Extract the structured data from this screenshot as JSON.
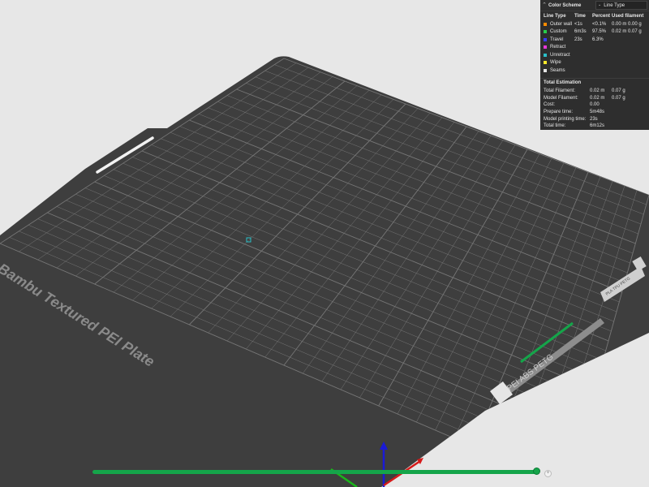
{
  "plate": {
    "label": "Bambu Textured PEI Plate",
    "sticker_main": "PEI ABS PETG",
    "sticker_side": "PLA TPU PETG"
  },
  "panel": {
    "color_scheme_label": "Color Scheme",
    "color_scheme_value": "Line Type",
    "columns": [
      "Line Type",
      "Time",
      "Percent",
      "Used filament"
    ],
    "rows": [
      {
        "label": "Outer wall",
        "color": "#ff8c00",
        "time": "<1s",
        "percent": "<0.1%",
        "used": "0.00 m  0.00 g"
      },
      {
        "label": "Custom",
        "color": "#28cc4a",
        "time": "6m3s",
        "percent": "97.5%",
        "used": "0.02 m  0.07 g"
      },
      {
        "label": "Travel",
        "color": "#3a3dff",
        "time": "23s",
        "percent": "6.3%",
        "used": ""
      },
      {
        "label": "Retract",
        "color": "#e838d9",
        "time": "",
        "percent": "",
        "used": ""
      },
      {
        "label": "Unretract",
        "color": "#2ac0c8",
        "time": "",
        "percent": "",
        "used": ""
      },
      {
        "label": "Wipe",
        "color": "#ffe82a",
        "time": "",
        "percent": "",
        "used": ""
      },
      {
        "label": "Seams",
        "color": "#e6e6e6",
        "time": "",
        "percent": "",
        "used": ""
      }
    ],
    "total_estimation": {
      "title": "Total Estimation",
      "rows": [
        {
          "key": "Total Filament:",
          "v1": "0.02 m",
          "v2": "0.07 g"
        },
        {
          "key": "Model Filament:",
          "v1": "0.02 m",
          "v2": "0.07 g"
        },
        {
          "key": "Cost:",
          "v1": "0.00",
          "v2": ""
        },
        {
          "key": "Prepare time:",
          "v1": "5m48s",
          "v2": ""
        },
        {
          "key": "Model printing time:",
          "v1": "23s",
          "v2": ""
        },
        {
          "key": "Total time:",
          "v1": "6m12s",
          "v2": ""
        }
      ]
    }
  },
  "slider": {
    "plus_label": "+"
  },
  "colors": {
    "plate": "#3e3e3e",
    "grid": "#767676",
    "background": "#e7e7e7",
    "accent_green": "#15a54a",
    "axis_blue": "#1a1ad6",
    "axis_red": "#d61a1a",
    "axis_green": "#1ab61a"
  }
}
